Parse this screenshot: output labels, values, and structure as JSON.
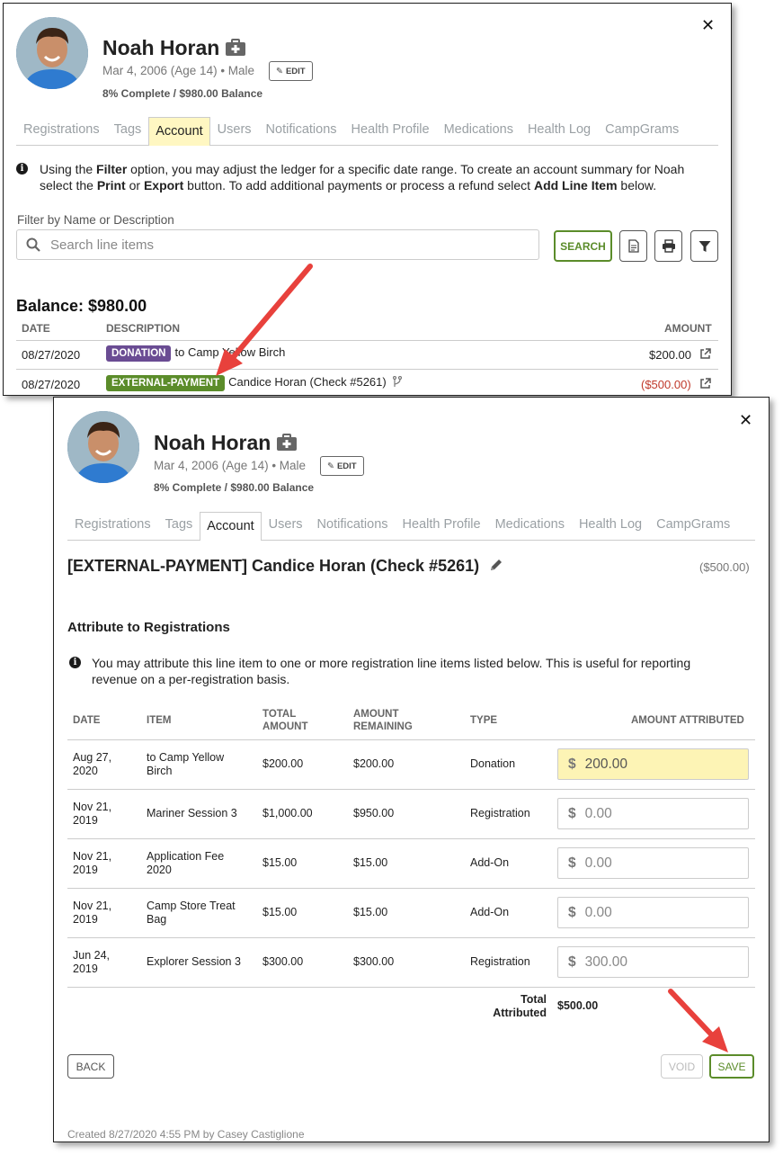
{
  "profile": {
    "name": "Noah Horan",
    "dob": "Mar 4, 2006 (Age 14) • Male",
    "edit_label": "EDIT",
    "progress": "8% Complete / $980.00 Balance"
  },
  "tabs": [
    "Registrations",
    "Tags",
    "Account",
    "Users",
    "Notifications",
    "Health Profile",
    "Medications",
    "Health Log",
    "CampGrams"
  ],
  "panel1": {
    "info_parts": {
      "p1": "Using the ",
      "b1": "Filter",
      "p2": " option, you may adjust the ledger for a specific date range. To create an account summary for Noah select the ",
      "b2": "Print",
      "p3": " or ",
      "b3": "Export",
      "p4": " button. To add additional payments or process a refund select ",
      "b4": "Add Line Item",
      "p5": " below."
    },
    "filter_label": "Filter by Name or Description",
    "search_placeholder": "Search line items",
    "search_button": "SEARCH",
    "balance": "Balance: $980.00",
    "columns": {
      "date": "DATE",
      "description": "DESCRIPTION",
      "amount": "AMOUNT"
    },
    "rows": [
      {
        "date": "08/27/2020",
        "badge": "DONATION",
        "desc": "to Camp Yellow Birch",
        "amount": "$200.00"
      },
      {
        "date": "08/27/2020",
        "badge": "EXTERNAL-PAYMENT",
        "desc": "Candice Horan (Check #5261)",
        "amount": "($500.00)"
      }
    ]
  },
  "panel2": {
    "title": "[EXTERNAL-PAYMENT] Candice Horan (Check #5261)",
    "amount": "($500.00)",
    "section_title": "Attribute to Registrations",
    "info": "You may attribute this line item to one or more registration line items listed below. This is useful for reporting revenue on a per-registration basis.",
    "columns": {
      "date": "DATE",
      "item": "ITEM",
      "total_1": "TOTAL",
      "total_2": "AMOUNT",
      "remaining_1": "AMOUNT",
      "remaining_2": "REMAINING",
      "type": "TYPE",
      "attributed": "AMOUNT ATTRIBUTED"
    },
    "rows": [
      {
        "date_1": "Aug 27,",
        "date_2": "2020",
        "item_1": "to Camp Yellow",
        "item_2": "Birch",
        "total": "$200.00",
        "remaining": "$200.00",
        "type": "Donation",
        "attributed": "200.00"
      },
      {
        "date_1": "Nov 21,",
        "date_2": "2019",
        "item_1": "Mariner Session 3",
        "item_2": "",
        "total": "$1,000.00",
        "remaining": "$950.00",
        "type": "Registration",
        "attributed": "0.00"
      },
      {
        "date_1": "Nov 21,",
        "date_2": "2019",
        "item_1": "Application Fee",
        "item_2": "2020",
        "total": "$15.00",
        "remaining": "$15.00",
        "type": "Add-On",
        "attributed": "0.00"
      },
      {
        "date_1": "Nov 21,",
        "date_2": "2019",
        "item_1": "Camp Store Treat",
        "item_2": "Bag",
        "total": "$15.00",
        "remaining": "$15.00",
        "type": "Add-On",
        "attributed": "0.00"
      },
      {
        "date_1": "Jun 24,",
        "date_2": "2019",
        "item_1": "Explorer Session 3",
        "item_2": "",
        "total": "$300.00",
        "remaining": "$300.00",
        "type": "Registration",
        "attributed": "300.00"
      }
    ],
    "total_label_1": "Total",
    "total_label_2": "Attributed",
    "total_value": "$500.00",
    "back_label": "BACK",
    "void_label": "VOID",
    "save_label": "SAVE",
    "created": "Created 8/27/2020 4:55 PM by Casey Castiglione"
  },
  "colors": {
    "donation_badge": "#6a4c93",
    "external_payment_badge": "#5b8c2a",
    "primary_green": "#5b8c2a",
    "annotation_arrow": "#e8413c",
    "highlight_yellow": "#fdf4b5"
  }
}
